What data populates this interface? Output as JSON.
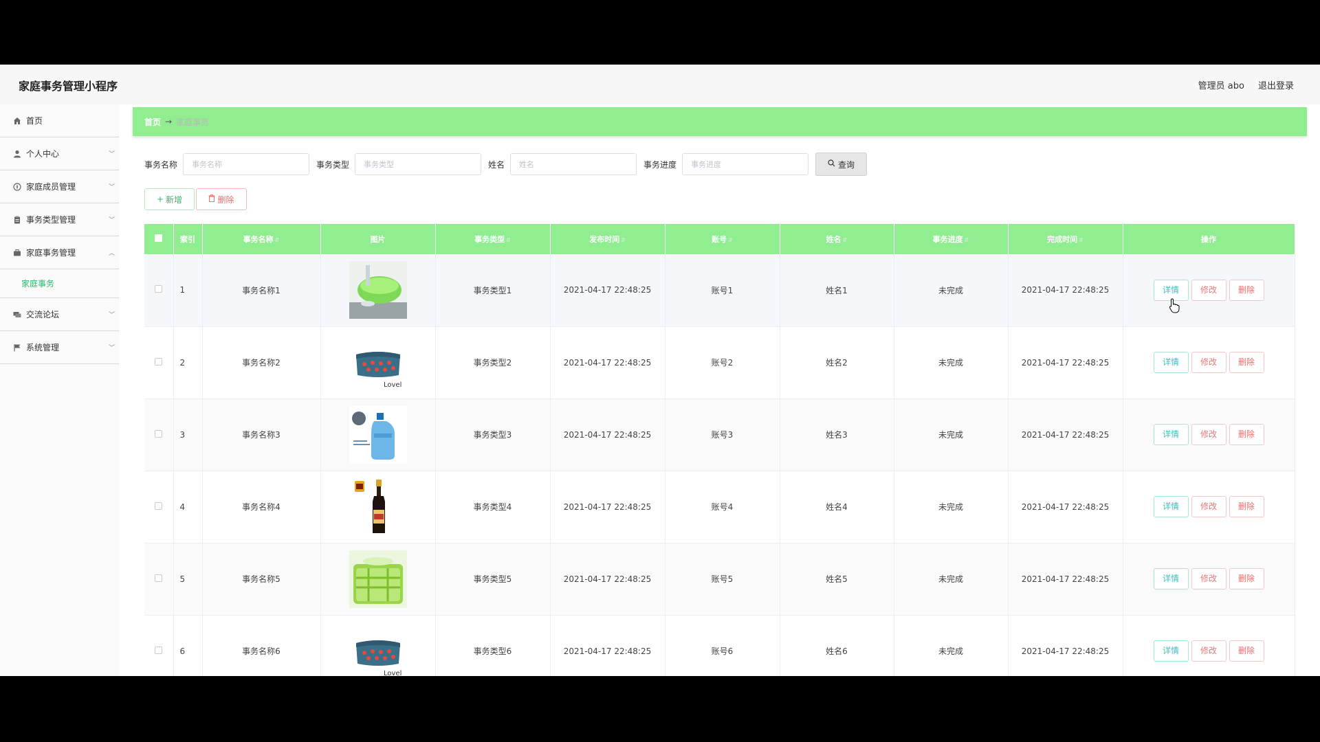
{
  "app": {
    "title": "家庭事务管理小程序"
  },
  "header": {
    "admin_label": "管理员 abo",
    "logout_label": "退出登录"
  },
  "sidebar": {
    "items": [
      {
        "label": "首页",
        "icon": "home-icon",
        "has_chevron": false
      },
      {
        "label": "个人中心",
        "icon": "user-icon",
        "has_chevron": true
      },
      {
        "label": "家庭成员管理",
        "icon": "compass-icon",
        "has_chevron": true
      },
      {
        "label": "事务类型管理",
        "icon": "clipboard-icon",
        "has_chevron": true
      },
      {
        "label": "家庭事务管理",
        "icon": "briefcase-icon",
        "has_chevron": true,
        "expanded": true
      }
    ],
    "subitem": {
      "label": "家庭事务"
    },
    "items_after": [
      {
        "label": "交流论坛",
        "icon": "forum-icon",
        "has_chevron": true
      },
      {
        "label": "系统管理",
        "icon": "flag-icon",
        "has_chevron": true
      }
    ]
  },
  "breadcrumb": {
    "home": "首页",
    "arrow": "→",
    "current": "家庭事务"
  },
  "search": {
    "fields": [
      {
        "label": "事务名称",
        "placeholder": "事务名称"
      },
      {
        "label": "事务类型",
        "placeholder": "事务类型"
      },
      {
        "label": "姓名",
        "placeholder": "姓名"
      },
      {
        "label": "事务进度",
        "placeholder": "事务进度"
      }
    ],
    "button_label": "查询"
  },
  "actions": {
    "add_label": "新增",
    "delete_label": "删除"
  },
  "table": {
    "headers": [
      "索引",
      "事务名称",
      "图片",
      "事务类型",
      "发布时间",
      "账号",
      "姓名",
      "事务进度",
      "完成时间",
      "操作"
    ],
    "op_labels": {
      "detail": "详情",
      "edit": "修改",
      "delete": "删除"
    },
    "rows": [
      {
        "index": "1",
        "name": "事务名称1",
        "image": "green-colander",
        "type": "事务类型1",
        "publish_time": "2021-04-17 22:48:25",
        "account": "账号1",
        "person": "姓名1",
        "progress": "未完成",
        "finish_time": "2021-04-17 22:48:25"
      },
      {
        "index": "2",
        "name": "事务名称2",
        "image": "cushion-lovel",
        "type": "事务类型2",
        "publish_time": "2021-04-17 22:48:25",
        "account": "账号2",
        "person": "姓名2",
        "progress": "未完成",
        "finish_time": "2021-04-17 22:48:25"
      },
      {
        "index": "3",
        "name": "事务名称3",
        "image": "water-bottle",
        "type": "事务类型3",
        "publish_time": "2021-04-17 22:48:25",
        "account": "账号3",
        "person": "姓名3",
        "progress": "未完成",
        "finish_time": "2021-04-17 22:48:25"
      },
      {
        "index": "4",
        "name": "事务名称4",
        "image": "sauce-bottle",
        "type": "事务类型4",
        "publish_time": "2021-04-17 22:48:25",
        "account": "账号4",
        "person": "姓名4",
        "progress": "未完成",
        "finish_time": "2021-04-17 22:48:25"
      },
      {
        "index": "5",
        "name": "事务名称5",
        "image": "green-basket",
        "type": "事务类型5",
        "publish_time": "2021-04-17 22:48:25",
        "account": "账号5",
        "person": "姓名5",
        "progress": "未完成",
        "finish_time": "2021-04-17 22:48:25"
      },
      {
        "index": "6",
        "name": "事务名称6",
        "image": "cushion-lovel",
        "type": "事务类型6",
        "publish_time": "2021-04-17 22:48:25",
        "account": "账号6",
        "person": "姓名6",
        "progress": "未完成",
        "finish_time": "2021-04-17 22:48:25"
      }
    ]
  },
  "image_text": {
    "lovel": "Lovel"
  },
  "colors": {
    "accent_green": "#90ee90",
    "active_menu": "#3cb371",
    "delete_red": "#f56c6c",
    "detail_teal": "#3cc0c0"
  }
}
